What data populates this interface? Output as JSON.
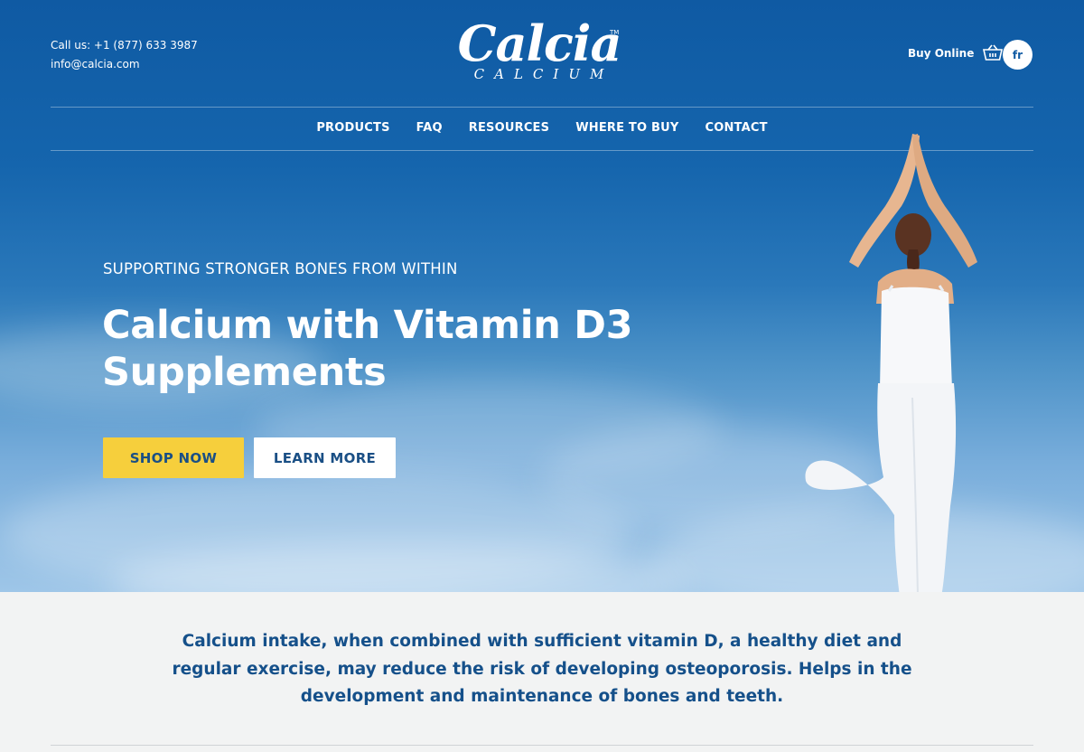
{
  "header": {
    "phone_text": "Call us: +1 (877) 633 3987",
    "email_text": "info@calcia.com",
    "logo": {
      "word": "Calcia",
      "trademark": "TM",
      "subword": "CALCIUM"
    },
    "buy_online_label": "Buy Online",
    "buy_icon": "basket-icon",
    "language_label": "fr"
  },
  "nav": {
    "items": [
      {
        "label": "PRODUCTS"
      },
      {
        "label": "FAQ"
      },
      {
        "label": "RESOURCES"
      },
      {
        "label": "WHERE TO BUY"
      },
      {
        "label": "CONTACT"
      }
    ]
  },
  "hero": {
    "eyebrow": "SUPPORTING STRONGER BONES FROM WITHIN",
    "headline": "Calcium with Vitamin D3 Supplements",
    "primary_cta": "SHOP NOW",
    "secondary_cta": "LEARN MORE",
    "image": "woman-yoga-tree-pose"
  },
  "intro": {
    "text": "Calcium intake, when combined with sufficient vitamin D, a healthy diet and regular exercise, may reduce the risk of developing osteoporosis. Helps in the development and maintenance of bones and teeth."
  },
  "colors": {
    "brand_blue": "#0f5aa3",
    "cta_yellow": "#f6cf3c",
    "text_blue": "#15508a",
    "intro_bg": "#f2f3f3"
  }
}
